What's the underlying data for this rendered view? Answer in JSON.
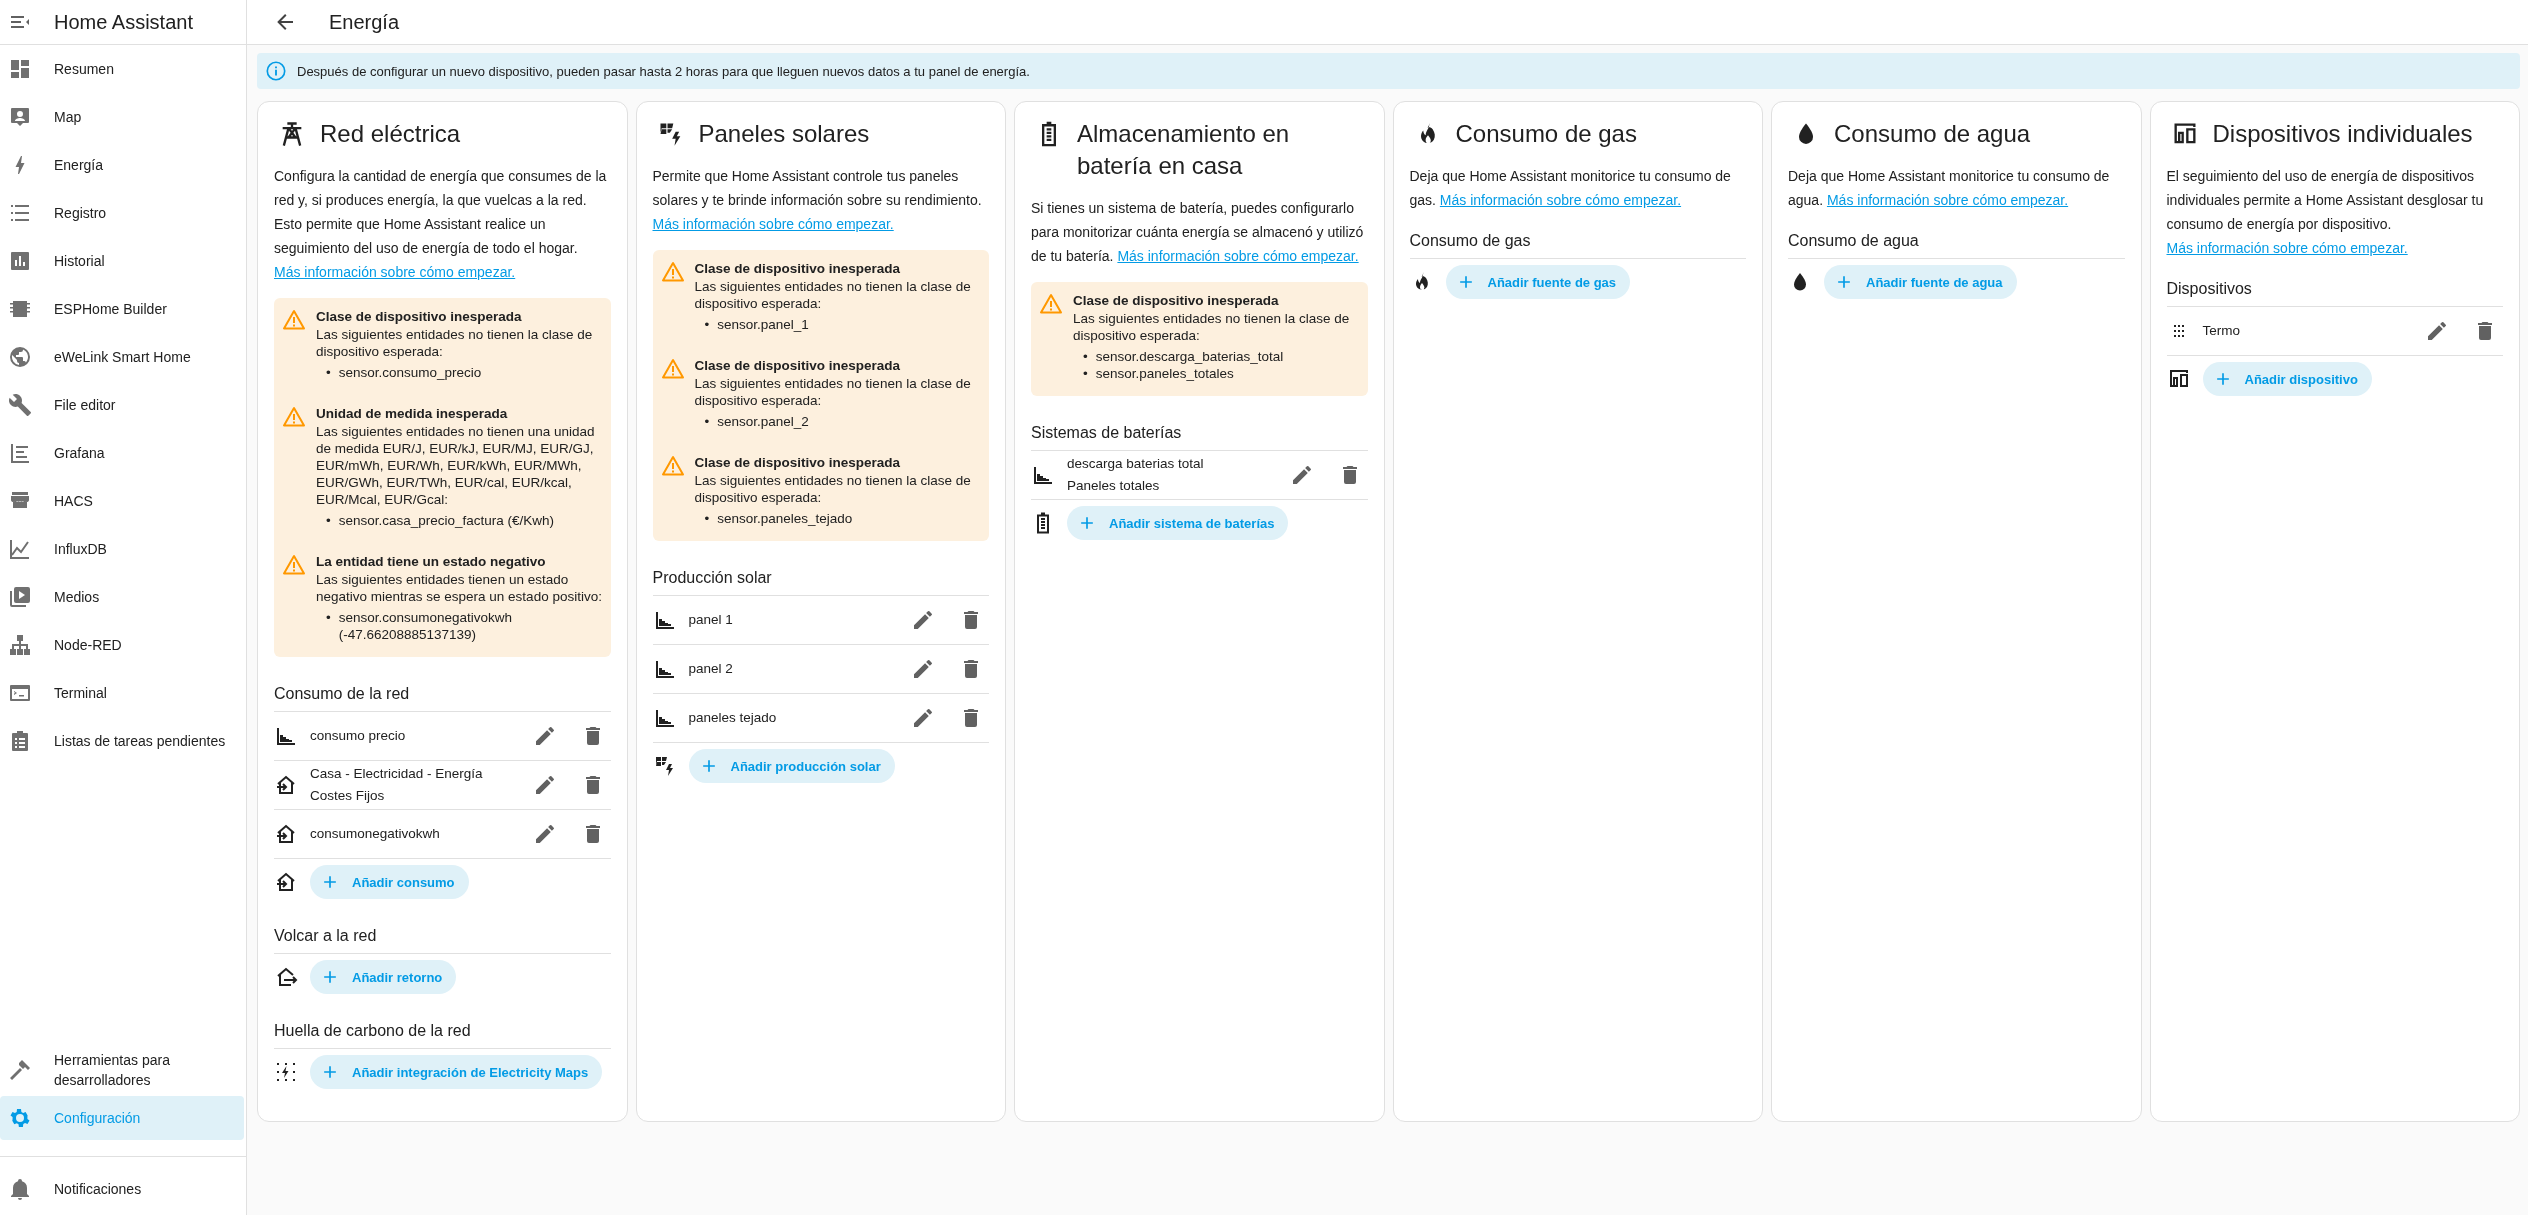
{
  "sidebar": {
    "title": "Home Assistant",
    "items": [
      {
        "kind": "dashboard",
        "label": "Resumen",
        "selected": false
      },
      {
        "kind": "map",
        "label": "Map",
        "selected": false
      },
      {
        "kind": "energy",
        "label": "Energía",
        "selected": false
      },
      {
        "kind": "logbook",
        "label": "Registro",
        "selected": false
      },
      {
        "kind": "history",
        "label": "Historial",
        "selected": false
      },
      {
        "kind": "chip",
        "label": "ESPHome Builder",
        "selected": false
      },
      {
        "kind": "globe",
        "label": "eWeLink Smart Home",
        "selected": false
      },
      {
        "kind": "wrench",
        "label": "File editor",
        "selected": false
      },
      {
        "kind": "grafana",
        "label": "Grafana",
        "selected": false
      },
      {
        "kind": "store",
        "label": "HACS",
        "selected": false
      },
      {
        "kind": "linechart",
        "label": "InfluxDB",
        "selected": false
      },
      {
        "kind": "media",
        "label": "Medios",
        "selected": false
      },
      {
        "kind": "sitemap",
        "label": "Node-RED",
        "selected": false
      },
      {
        "kind": "terminal",
        "label": "Terminal",
        "selected": false
      },
      {
        "kind": "clipboard",
        "label": "Listas de tareas pendientes",
        "selected": false
      }
    ],
    "bottom_items": [
      {
        "kind": "hammer",
        "label": "Herramientas para desarrolladores",
        "selected": false
      },
      {
        "kind": "gear",
        "label": "Configuración",
        "selected": true
      }
    ],
    "notifications": {
      "kind": "bell",
      "label": "Notificaciones"
    }
  },
  "header": {
    "title": "Energía"
  },
  "info_banner": "Después de configurar un nuevo dispositivo, pueden pasar hasta 2 horas para que lleguen nuevos datos a tu panel de energía.",
  "cards": [
    {
      "kind": "tower",
      "title": "Red eléctrica",
      "description": "Configura la cantidad de energía que consumes de la red y, si produces energía, la que vuelcas a la red. Esto permite que Home Assistant realice un seguimiento del uso de energía de todo el hogar.",
      "link": "Más información sobre cómo empezar.",
      "warnings": [
        {
          "title": "Clase de dispositivo inesperada",
          "text": "Las siguientes entidades no tienen la clase de dispositivo esperada:",
          "entities": [
            {
              "bullet": "•",
              "id": "sensor.consumo_precio"
            }
          ]
        },
        {
          "title": "Unidad de medida inesperada",
          "text": "Las siguientes entidades no tienen una unidad de medida EUR/J, EUR/kJ, EUR/MJ, EUR/GJ, EUR/mWh, EUR/Wh, EUR/kWh, EUR/MWh, EUR/GWh, EUR/TWh, EUR/cal, EUR/kcal, EUR/Mcal, EUR/Gcal:",
          "entities": [
            {
              "bullet": "•",
              "id": "sensor.casa_precio_factura (€/Kwh)"
            }
          ]
        },
        {
          "title": "La entidad tiene un estado negativo",
          "text": "Las siguientes entidades tienen un estado negativo mientras se espera un estado positivo:",
          "entities": [
            {
              "bullet": "•",
              "id": "sensor.consumonegativokwh (-47.66208885137139)"
            }
          ]
        }
      ],
      "sections": [
        {
          "title": "Consumo de la red",
          "rows": [
            {
              "kind": "chart",
              "lines": [
                "consumo precio"
              ]
            },
            {
              "kind": "import",
              "lines": [
                "Casa - Electricidad - Energía",
                "Costes Fijos"
              ]
            },
            {
              "kind": "import",
              "lines": [
                "consumonegativokwh"
              ]
            }
          ],
          "add": {
            "kind": "import",
            "label": "Añadir consumo"
          }
        },
        {
          "title": "Volcar a la red",
          "add": {
            "kind": "export",
            "label": "Añadir retorno"
          }
        },
        {
          "title": "Huella de carbono de la red",
          "add": {
            "kind": "carbon",
            "label": "Añadir integración de Electricity Maps"
          }
        }
      ]
    },
    {
      "kind": "solar",
      "title": "Paneles solares",
      "description": "Permite que Home Assistant controle tus paneles solares y te brinde información sobre su rendimiento.",
      "link": "Más información sobre cómo empezar.",
      "warnings": [
        {
          "title": "Clase de dispositivo inesperada",
          "text": "Las siguientes entidades no tienen la clase de dispositivo esperada:",
          "entities": [
            {
              "bullet": "•",
              "id": "sensor.panel_1"
            }
          ]
        },
        {
          "title": "Clase de dispositivo inesperada",
          "text": "Las siguientes entidades no tienen la clase de dispositivo esperada:",
          "entities": [
            {
              "bullet": "•",
              "id": "sensor.panel_2"
            }
          ]
        },
        {
          "title": "Clase de dispositivo inesperada",
          "text": "Las siguientes entidades no tienen la clase de dispositivo esperada:",
          "entities": [
            {
              "bullet": "•",
              "id": "sensor.paneles_tejado"
            }
          ]
        }
      ],
      "sections": [
        {
          "title": "Producción solar",
          "rows": [
            {
              "kind": "chart",
              "lines": [
                "panel 1"
              ]
            },
            {
              "kind": "chart",
              "lines": [
                "panel 2"
              ]
            },
            {
              "kind": "chart",
              "lines": [
                "paneles tejado"
              ]
            }
          ],
          "add": {
            "kind": "solar",
            "label": "Añadir producción solar"
          }
        }
      ]
    },
    {
      "kind": "battery",
      "title": "Almacenamiento en batería en casa",
      "description": "Si tienes un sistema de batería, puedes configurarlo para monitorizar cuánta energía se almacenó y utilizó de tu batería.",
      "link": "Más información sobre cómo empezar.",
      "warnings": [
        {
          "title": "Clase de dispositivo inesperada",
          "text": "Las siguientes entidades no tienen la clase de dispositivo esperada:",
          "entities": [
            {
              "bullet": "•",
              "id": "sensor.descarga_baterias_total"
            },
            {
              "bullet": "•",
              "id": "sensor.paneles_totales"
            }
          ]
        }
      ],
      "sections": [
        {
          "title": "Sistemas de baterías",
          "rows": [
            {
              "kind": "chart",
              "lines": [
                "descarga baterias total",
                "Paneles totales"
              ]
            }
          ],
          "add": {
            "kind": "battery",
            "label": "Añadir sistema de baterías"
          }
        }
      ]
    },
    {
      "kind": "fire",
      "title": "Consumo de gas",
      "description": "Deja que Home Assistant monitorice tu consumo de gas.",
      "link": "Más información sobre cómo empezar.",
      "sections": [
        {
          "title": "Consumo de gas",
          "add": {
            "kind": "fire",
            "label": "Añadir fuente de gas"
          }
        }
      ]
    },
    {
      "kind": "water",
      "title": "Consumo de agua",
      "description": "Deja que Home Assistant monitorice tu consumo de agua.",
      "link": "Más información sobre cómo empezar.",
      "sections": [
        {
          "title": "Consumo de agua",
          "add": {
            "kind": "water",
            "label": "Añadir fuente de agua"
          }
        }
      ]
    },
    {
      "kind": "devices",
      "title": "Dispositivos individuales",
      "description": "El seguimiento del uso de energía de dispositivos individuales permite a Home Assistant desglosar tu consumo de energía por dispositivo.",
      "link": "Más información sobre cómo empezar.",
      "sections": [
        {
          "title": "Dispositivos",
          "rows": [
            {
              "kind": "drag",
              "lines": [
                "Termo"
              ]
            }
          ],
          "add": {
            "kind": "devices",
            "label": "Añadir dispositivo"
          }
        }
      ]
    }
  ]
}
